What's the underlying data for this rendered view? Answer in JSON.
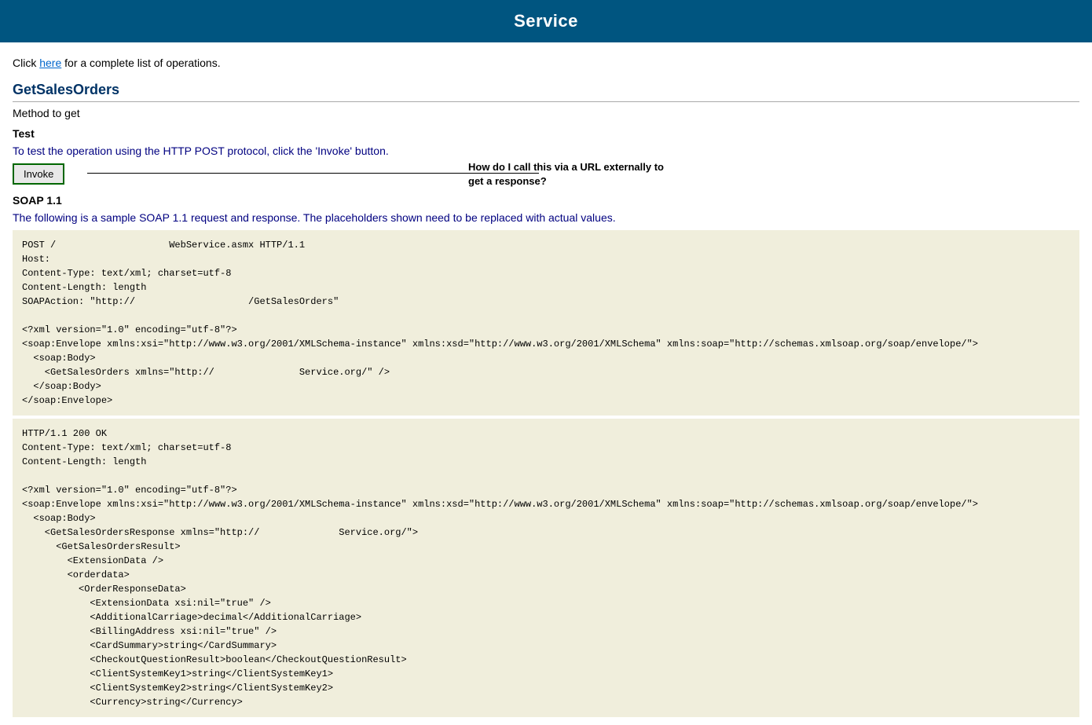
{
  "header": {
    "title": "Service"
  },
  "clickLine": {
    "prefix": "Click ",
    "linkText": "here",
    "suffix": " for a complete list of operations."
  },
  "operation": {
    "name": "GetSalesOrders",
    "methodDesc": "Method to get"
  },
  "test": {
    "label": "Test",
    "description": "To test the operation using the HTTP POST protocol, click the 'Invoke' button.",
    "invokeLabel": "Invoke",
    "annotationText": "How do I call this via a URL externally to get a response?"
  },
  "soap11": {
    "sectionTitle": "SOAP 1.1",
    "description": "The following is a sample SOAP 1.1 request and response. The placeholders shown need to be replaced with actual values.",
    "requestBlock": "POST /                    WebService.asmx HTTP/1.1\nHost:\nContent-Type: text/xml; charset=utf-8\nContent-Length: length\nSOAPAction: \"http://                    /GetSalesOrders\"\n\n<?xml version=\"1.0\" encoding=\"utf-8\"?>\n<soap:Envelope xmlns:xsi=\"http://www.w3.org/2001/XMLSchema-instance\" xmlns:xsd=\"http://www.w3.org/2001/XMLSchema\" xmlns:soap=\"http://schemas.xmlsoap.org/soap/envelope/\">\n  <soap:Body>\n    <GetSalesOrders xmlns=\"http://               Service.org/\" />\n  </soap:Body>\n</soap:Envelope>",
    "responseBlock": "HTTP/1.1 200 OK\nContent-Type: text/xml; charset=utf-8\nContent-Length: length\n\n<?xml version=\"1.0\" encoding=\"utf-8\"?>\n<soap:Envelope xmlns:xsi=\"http://www.w3.org/2001/XMLSchema-instance\" xmlns:xsd=\"http://www.w3.org/2001/XMLSchema\" xmlns:soap=\"http://schemas.xmlsoap.org/soap/envelope/\">\n  <soap:Body>\n    <GetSalesOrdersResponse xmlns=\"http://              Service.org/\">\n      <GetSalesOrdersResult>\n        <ExtensionData />\n        <orderdata>\n          <OrderResponseData>\n            <ExtensionData xsi:nil=\"true\" />\n            <AdditionalCarriage>decimal</AdditionalCarriage>\n            <BillingAddress xsi:nil=\"true\" />\n            <CardSummary>string</CardSummary>\n            <CheckoutQuestionResult>boolean</CheckoutQuestionResult>\n            <ClientSystemKey1>string</ClientSystemKey1>\n            <ClientSystemKey2>string</ClientSystemKey2>\n            <Currency>string</Currency>"
  }
}
